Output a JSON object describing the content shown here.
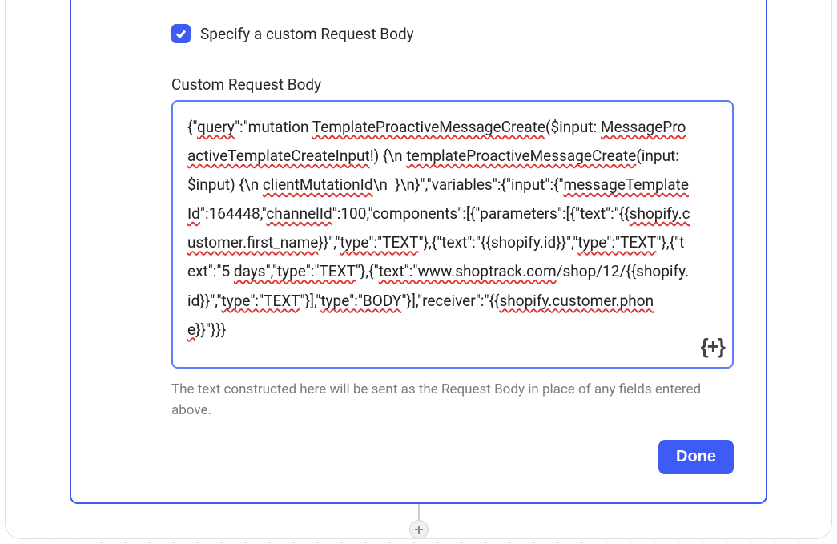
{
  "checkbox": {
    "checked": true,
    "label": "Specify a custom Request Body"
  },
  "field": {
    "label": "Custom Request Body",
    "value_segments": [
      {
        "t": "{\""
      },
      {
        "t": "query",
        "err": true
      },
      {
        "t": "\":\"mutation "
      },
      {
        "t": "TemplateProactiveMessageCreate",
        "err": true
      },
      {
        "t": "($input: "
      },
      {
        "t": "MessageProactiveTemplateCreateInput",
        "err": true
      },
      {
        "t": "!) {\\n "
      },
      {
        "t": "templateProactiveMessageCreate",
        "err": true
      },
      {
        "t": "(input: $input) {\\n "
      },
      {
        "t": "clientMutationId",
        "err": true
      },
      {
        "t": "\\n  }\\n}\",\"variables\":{\"input\":{\""
      },
      {
        "t": "messageTemplateId",
        "err": true
      },
      {
        "t": "\":164448,\""
      },
      {
        "t": "channelId",
        "err": true
      },
      {
        "t": "\":100,\"components\":[{\"parameters\":[{\"text\":\"{{"
      },
      {
        "t": "shopify.customer.first_name",
        "err": true
      },
      {
        "t": "}}\",\""
      },
      {
        "t": "type\":\"TEXT",
        "err": true
      },
      {
        "t": "\"},{\"text\":\"{{shopify.id}}\",\""
      },
      {
        "t": "type\":\"TEXT",
        "err": true
      },
      {
        "t": "\"},{\"text\":\"5 "
      },
      {
        "t": "days\",\"type\":\"TEXT",
        "err": true
      },
      {
        "t": "\"},{\""
      },
      {
        "t": "text\":\"www.shoptrack.com",
        "err": true
      },
      {
        "t": "/shop/12/{{shopify.id}}\",\""
      },
      {
        "t": "type\":\"TEXT",
        "err": true
      },
      {
        "t": "\"}],\""
      },
      {
        "t": "typ",
        "err": true
      },
      {
        "t": "e\":\"BODY",
        "err": true
      },
      {
        "t": "\"}],\"receiver\":\"{{"
      },
      {
        "t": "shopify.customer.phone",
        "err": true
      },
      {
        "t": "}}\"}}}"
      }
    ],
    "helper": "The text constructed here will be sent as the Request Body in place of any fields entered above."
  },
  "insert_button_label": "{+}",
  "done_label": "Done"
}
